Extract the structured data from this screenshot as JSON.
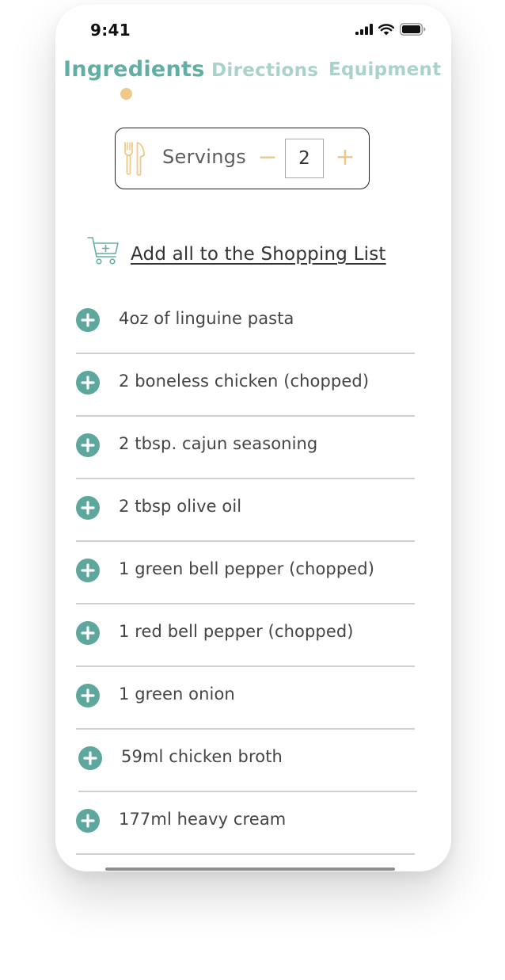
{
  "status_bar": {
    "time": "9:41"
  },
  "tabs": [
    {
      "label": "Ingredients",
      "active": true
    },
    {
      "label": "Directions",
      "active": false
    },
    {
      "label": "Equipment",
      "active": false
    }
  ],
  "servings": {
    "label": "Servings",
    "count": "2",
    "minus": "−",
    "plus": "+"
  },
  "shopping_list": {
    "link_label": "Add all to the Shopping List"
  },
  "ingredients": [
    "4oz of linguine pasta",
    "2 boneless chicken (chopped)",
    "2 tbsp. cajun seasoning",
    "2 tbsp olive oil",
    "1 green bell pepper (chopped)",
    "1 red bell pepper (chopped)",
    "1 green onion",
    "59ml chicken broth",
    "177ml heavy cream"
  ],
  "colors": {
    "accent_teal": "#63aea4",
    "inactive_tab": "#a9d2cc",
    "accent_gold": "#f0c98a",
    "add_icon": "#5ea79d"
  },
  "icons": {
    "utensils": "utensils-icon",
    "cart": "cart-plus-icon",
    "add": "plus-circle-icon",
    "signal": "cellular-signal-icon",
    "wifi": "wifi-icon",
    "battery": "battery-icon"
  }
}
